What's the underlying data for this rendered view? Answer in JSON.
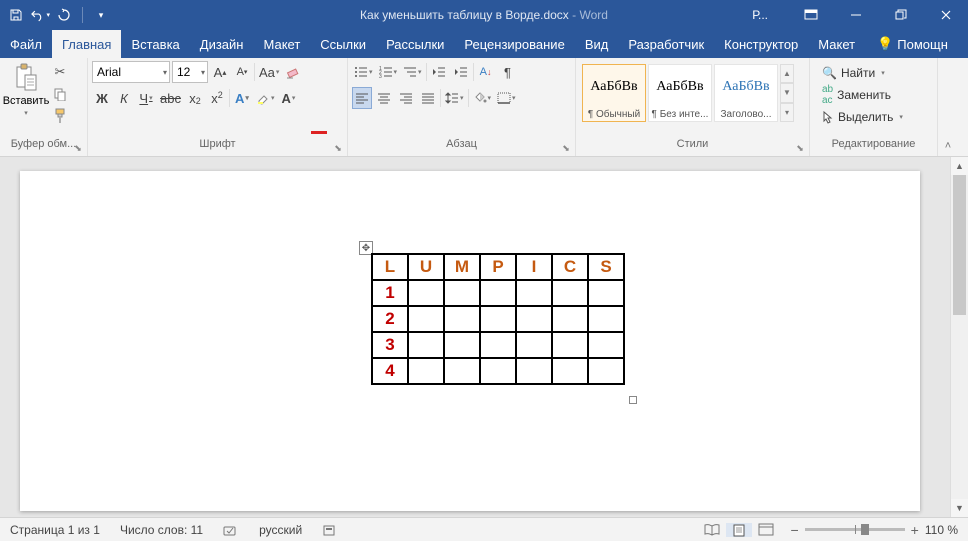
{
  "titlebar": {
    "doc_name": "Как уменьшить таблицу в Ворде.docx",
    "app_name": "Word",
    "tabtools_label": "Р..."
  },
  "tabs": {
    "file": "Файл",
    "home": "Главная",
    "insert": "Вставка",
    "design": "Дизайн",
    "layout": "Макет",
    "references": "Ссылки",
    "mailings": "Рассылки",
    "review": "Рецензирование",
    "view": "Вид",
    "developer": "Разработчик",
    "tbl_design": "Конструктор",
    "tbl_layout": "Макет",
    "help": "Помощн"
  },
  "ribbon": {
    "clipboard": {
      "paste": "Вставить",
      "label": "Буфер обм..."
    },
    "font": {
      "name": "Arial",
      "size": "12",
      "label": "Шрифт",
      "bold": "Ж",
      "italic": "К",
      "underline": "Ч",
      "strike": "abc",
      "case": "Aa"
    },
    "paragraph": {
      "label": "Абзац"
    },
    "styles": {
      "label": "Стили",
      "sample": "АаБбВв",
      "items": [
        "¶ Обычный",
        "¶ Без инте...",
        "Заголово..."
      ]
    },
    "editing": {
      "label": "Редактирование",
      "find": "Найти",
      "replace": "Заменить",
      "select": "Выделить"
    }
  },
  "document": {
    "table": {
      "header": [
        "L",
        "U",
        "M",
        "P",
        "I",
        "C",
        "S"
      ],
      "rows": [
        "1",
        "2",
        "3",
        "4"
      ]
    }
  },
  "statusbar": {
    "page": "Страница 1 из 1",
    "words": "Число слов: 11",
    "lang": "русский",
    "zoom": "110 %"
  }
}
